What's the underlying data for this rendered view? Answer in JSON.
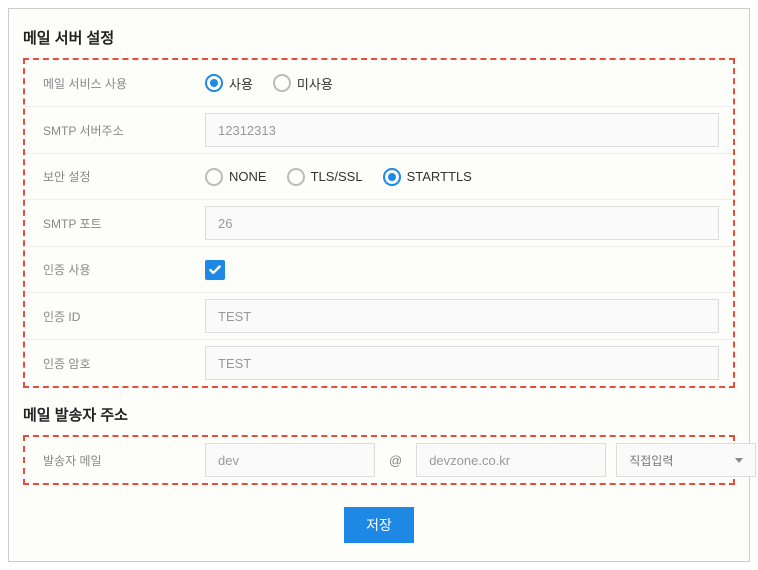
{
  "section1": {
    "title": "메일 서버 설정",
    "rows": {
      "mailService": {
        "label": "메일 서비스 사용",
        "option1": "사용",
        "option2": "미사용",
        "selected": "사용"
      },
      "smtpAddress": {
        "label": "SMTP 서버주소",
        "value": "12312313"
      },
      "security": {
        "label": "보안 설정",
        "option1": "NONE",
        "option2": "TLS/SSL",
        "option3": "STARTTLS",
        "selected": "STARTTLS"
      },
      "smtpPort": {
        "label": "SMTP 포트",
        "value": "26"
      },
      "auth": {
        "label": "인증 사용",
        "checked": "true"
      },
      "authId": {
        "label": "인증 ID",
        "value": "TEST"
      },
      "authPw": {
        "label": "인증 암호",
        "value": "TEST"
      }
    }
  },
  "section2": {
    "title": "메일 발송자 주소",
    "senderMail": {
      "label": "발송자 메일",
      "local": "dev",
      "at": "@",
      "domain": "devzone.co.kr",
      "domainSelector": "직접입력"
    }
  },
  "buttons": {
    "save": "저장"
  }
}
